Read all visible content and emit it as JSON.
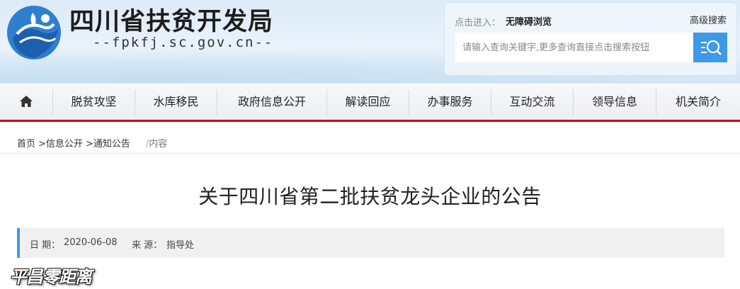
{
  "header": {
    "site_title": "四川省扶贫开发局",
    "site_domain": "--fpkfj.sc.gov.cn--"
  },
  "search": {
    "access_label": "点击进入：",
    "access_link": "无障碍浏览",
    "advanced_label": "高级搜索",
    "placeholder": "请输入查询关键字,更多查询直接点击搜索按钮"
  },
  "nav": {
    "items": [
      {
        "label": "脱贫攻坚"
      },
      {
        "label": "水库移民"
      },
      {
        "label": "政府信息公开"
      },
      {
        "label": "解读回应"
      },
      {
        "label": "办事服务"
      },
      {
        "label": "互动交流"
      },
      {
        "label": "领导信息"
      },
      {
        "label": "机关简介"
      }
    ]
  },
  "breadcrumb": {
    "items": [
      "首页",
      "信息公开",
      "通知公告"
    ],
    "separator": ">",
    "divider": "/",
    "current": "内容"
  },
  "article": {
    "title": "关于四川省第二批扶贫龙头企业的公告",
    "date_label": "日 期：",
    "date_value": "2020-06-08",
    "source_label": "来 源：",
    "source_value": "指导处"
  },
  "watermark": "平昌零距离",
  "colors": {
    "accent_blue": "#3e99e6",
    "nav_bottom_red": "#c5001a",
    "logo_blue": "#2f7fd0"
  }
}
